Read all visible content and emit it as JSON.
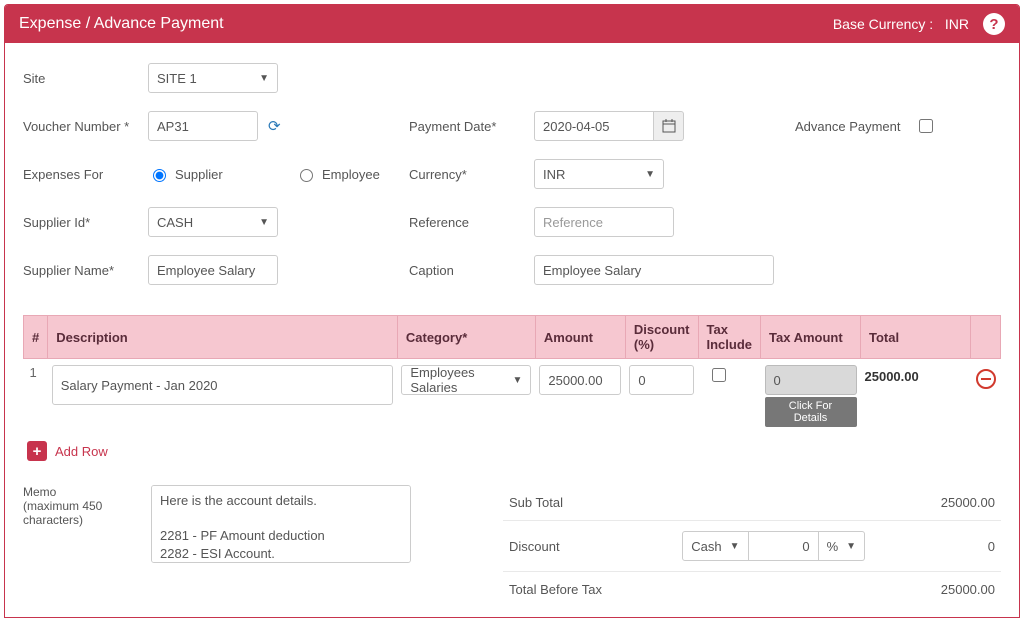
{
  "header": {
    "title": "Expense / Advance Payment",
    "base_currency_label": "Base Currency :",
    "base_currency_value": "INR",
    "help": "?"
  },
  "form": {
    "site_label": "Site",
    "site_value": "SITE 1",
    "voucher_label": "Voucher Number *",
    "voucher_value": "AP31",
    "expenses_for_label": "Expenses For",
    "expenses_for_options": {
      "supplier": "Supplier",
      "employee": "Employee"
    },
    "supplier_id_label": "Supplier Id*",
    "supplier_id_value": "CASH",
    "supplier_name_label": "Supplier Name*",
    "supplier_name_value": "Employee Salary",
    "payment_date_label": "Payment Date*",
    "payment_date_value": "2020-04-05",
    "currency_label": "Currency*",
    "currency_value": "INR",
    "reference_label": "Reference",
    "reference_placeholder": "Reference",
    "caption_label": "Caption",
    "caption_value": "Employee Salary",
    "advance_payment_label": "Advance Payment"
  },
  "table": {
    "headers": {
      "num": "#",
      "description": "Description",
      "category": "Category*",
      "amount": "Amount",
      "discount": "Discount (%)",
      "tax_include": "Tax Include",
      "tax_amount": "Tax Amount",
      "total": "Total"
    },
    "rows": [
      {
        "idx": "1",
        "description": "Salary Payment - Jan 2020",
        "category": "Employees Salaries",
        "amount": "25000.00",
        "discount": "0",
        "tax_amount": "0",
        "total": "25000.00"
      }
    ],
    "click_details": "Click For Details",
    "add_row_label": "Add Row"
  },
  "memo": {
    "label": "Memo\n(maximum 450 characters)",
    "value": "Here is the account details.\n\n2281 - PF Amount deduction\n2282 - ESI Account."
  },
  "totals": {
    "sub_total_label": "Sub Total",
    "sub_total_value": "25000.00",
    "discount_label": "Discount",
    "discount_type": "Cash",
    "discount_input": "0",
    "discount_unit": "%",
    "discount_value": "0",
    "total_before_tax_label": "Total Before Tax",
    "total_before_tax_value": "25000.00"
  }
}
